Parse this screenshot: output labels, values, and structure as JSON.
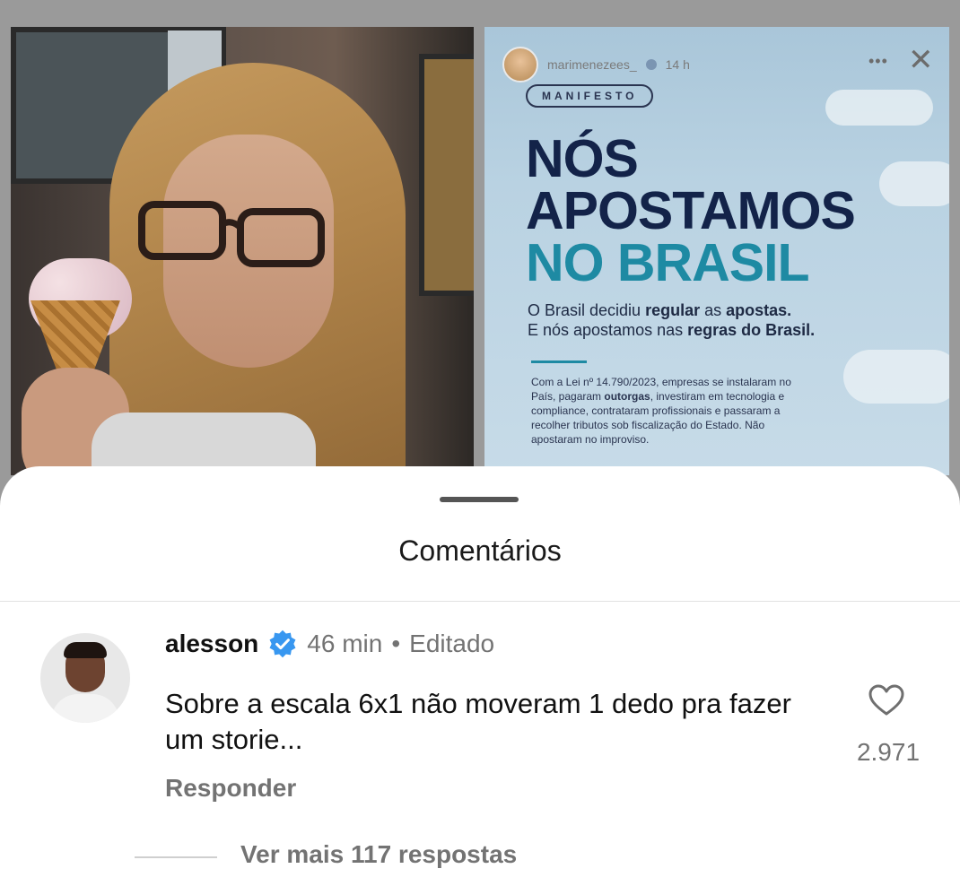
{
  "story_right": {
    "username": "marimenezees_",
    "time": "14 h",
    "pill": "MANIFESTO",
    "headline": [
      "NÓS",
      "APOSTAMOS",
      "NO BRASIL"
    ],
    "sub_line1_a": "O Brasil decidiu ",
    "sub_line1_b": "regular",
    "sub_line1_c": " as ",
    "sub_line1_d": "apostas.",
    "sub_line2_a": "E nós apostamos nas ",
    "sub_line2_b": "regras do Brasil.",
    "law_a": "Com a Lei nº 14.790/2023, empresas se instalaram no País, pagaram ",
    "law_b": "outorgas",
    "law_c": ", investiram em tecnologia e compliance, contrataram profissionais e passaram a recolher tributos sob fiscalização do Estado. Não apostaram no improviso."
  },
  "sheet": {
    "title": "Comentários"
  },
  "comment": {
    "username": "alesson",
    "time_ago": "46 min",
    "separator": "•",
    "edited": "Editado",
    "text": "Sobre a escala 6x1 não moveram 1 dedo pra fazer um storie...",
    "reply_label": "Responder",
    "like_count": "2.971",
    "more_replies": "Ver mais 117 respostas"
  },
  "colors": {
    "verified": "#3897f0",
    "muted_text": "#737373",
    "headline_navy": "#132349",
    "headline_teal": "#1e8aa3"
  },
  "icons": [
    "verified-badge-icon",
    "heart-icon",
    "more-options-icon",
    "close-icon"
  ]
}
